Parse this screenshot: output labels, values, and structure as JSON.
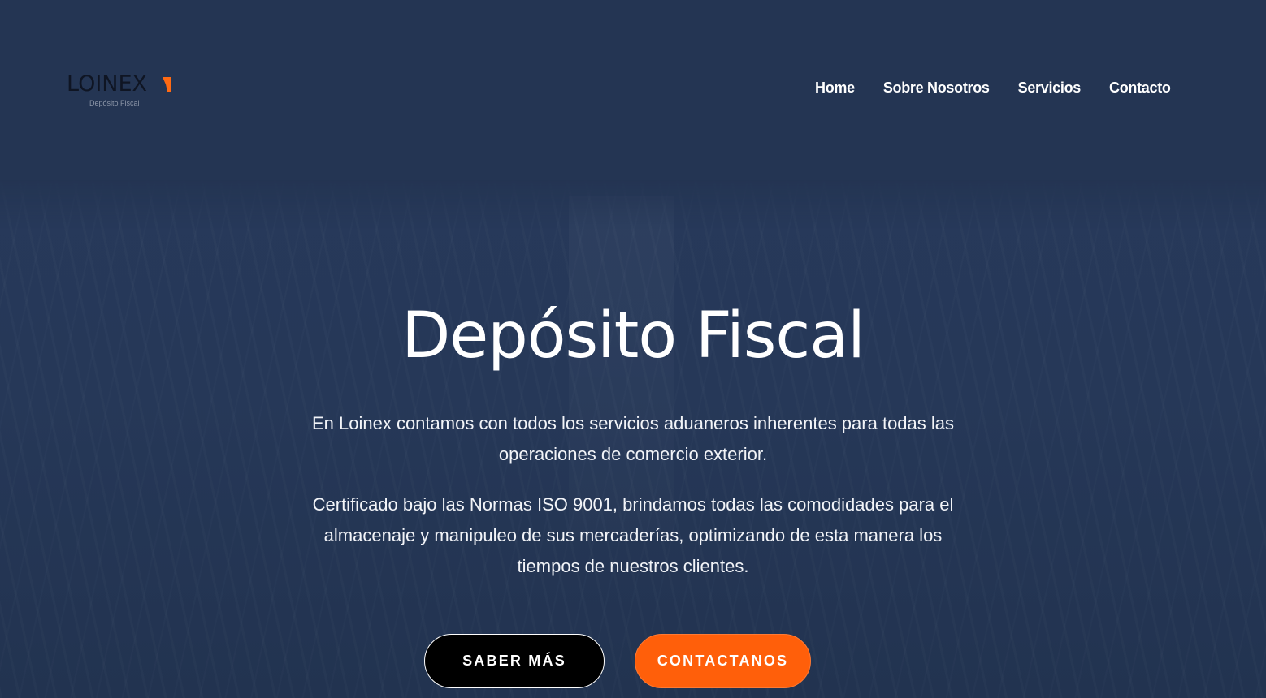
{
  "brand": {
    "name": "LOINEX",
    "tagline": "Depósito Fiscal",
    "accent_color": "#ff6a13"
  },
  "nav": {
    "items": [
      {
        "label": "Home"
      },
      {
        "label": "Sobre Nosotros"
      },
      {
        "label": "Servicios"
      },
      {
        "label": "Contacto"
      }
    ]
  },
  "hero": {
    "title": "Depósito Fiscal",
    "paragraph_1": "En Loinex contamos con todos los servicios aduaneros inherentes para todas las operaciones de comercio exterior.",
    "paragraph_2": "Certificado bajo las Normas ISO 9001, brindamos todas las comodidades para el almacenaje y manipuleo de sus mercaderías, optimizando de esta manera los tiempos de nuestros clientes."
  },
  "buttons": {
    "more_label": "SABER MÁS",
    "contact_label": "CONTACTANOS"
  },
  "colors": {
    "background": "#243553",
    "primary_button": "#000000",
    "secondary_button": "#ff5f0a"
  }
}
